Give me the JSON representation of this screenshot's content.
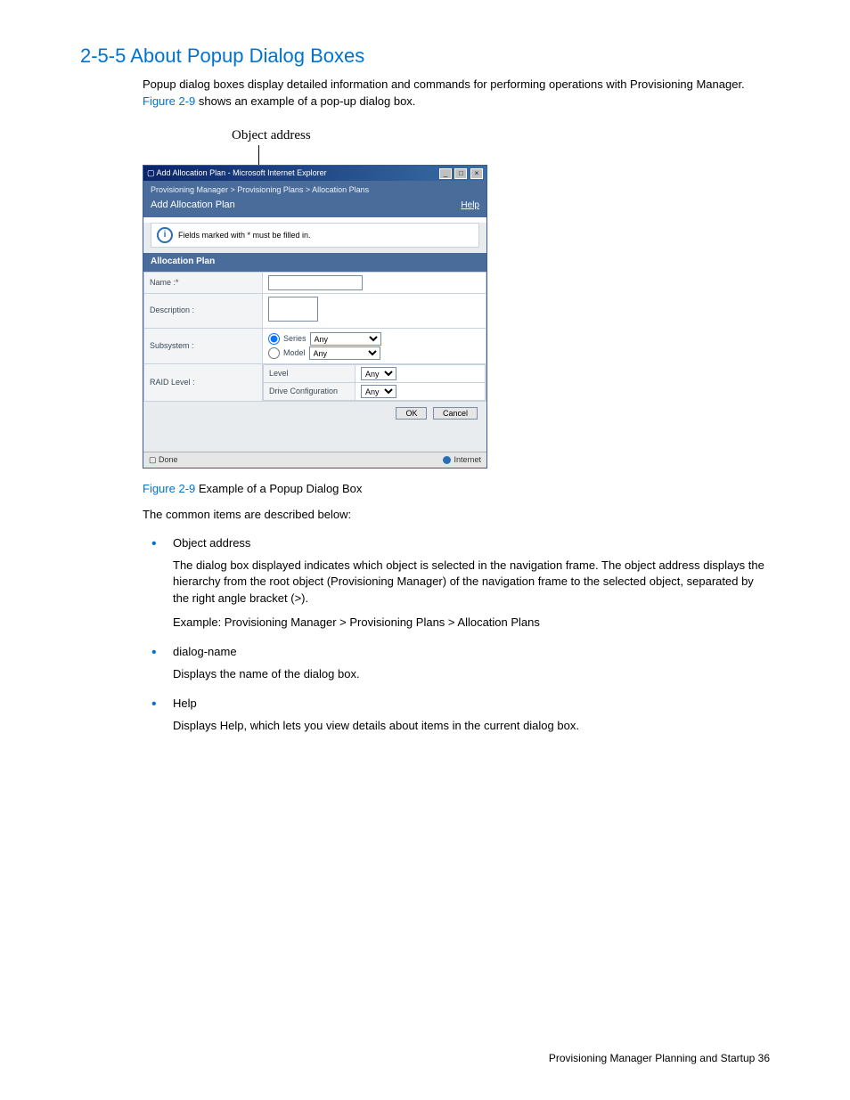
{
  "heading": "2-5-5 About Popup Dialog Boxes",
  "intro_part1": "Popup dialog boxes display detailed information and commands for performing operations with Provisioning Manager. ",
  "intro_figref": "Figure 2-9",
  "intro_part2": " shows an example of a pop-up dialog box.",
  "callout": "Object address",
  "dialog": {
    "window_title": "Add Allocation Plan - Microsoft Internet Explorer",
    "breadcrumb": "Provisioning Manager > Provisioning Plans > Allocation Plans",
    "title": "Add Allocation Plan",
    "help": "Help",
    "info": "Fields marked with * must be filled in.",
    "section": "Allocation Plan",
    "name_label": "Name :*",
    "desc_label": "Description :",
    "subsystem_label": "Subsystem :",
    "series_label": "Series",
    "model_label": "Model",
    "any": "Any",
    "raid_label": "RAID Level :",
    "level_label": "Level",
    "drivecfg_label": "Drive Configuration",
    "ok": "OK",
    "cancel": "Cancel",
    "status_done": "Done",
    "status_zone": "Internet"
  },
  "fig_caption_ref": "Figure 2-9",
  "fig_caption_text": " Example of a Popup Dialog Box",
  "common_intro": "The common items are described below:",
  "bullets": [
    {
      "title": "Object address",
      "paras": [
        "The dialog box displayed indicates which object is selected in the navigation frame. The object address displays the hierarchy from the root object (Provisioning Manager) of the navigation frame to the selected object, separated by the right angle bracket (>).",
        "Example: Provisioning Manager > Provisioning Plans > Allocation Plans"
      ]
    },
    {
      "title": "dialog-name",
      "paras": [
        "Displays the name of the dialog box."
      ]
    },
    {
      "title": "Help",
      "paras": [
        "Displays Help, which lets you view details about items in the current dialog box."
      ]
    }
  ],
  "footer": "Provisioning Manager Planning and Startup  36"
}
